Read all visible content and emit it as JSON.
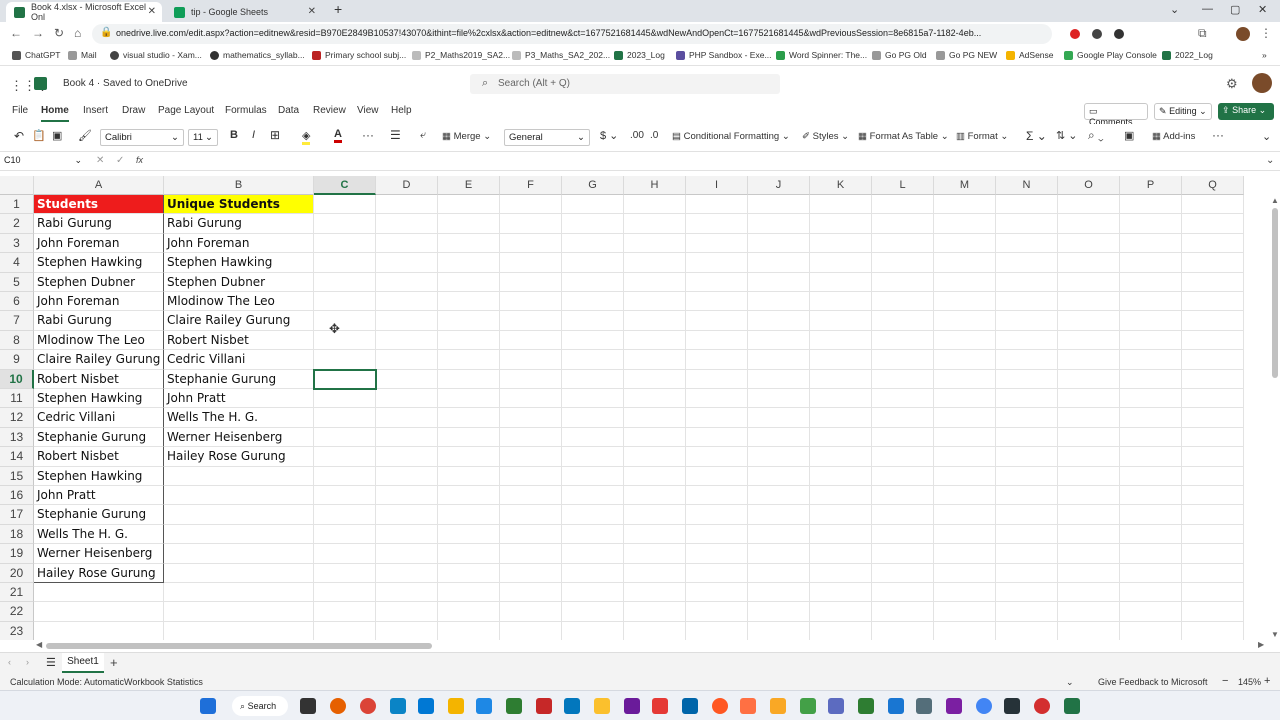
{
  "browser": {
    "tabs": [
      {
        "title": "Book 4.xlsx - Microsoft Excel Onl",
        "color": "#217346"
      },
      {
        "title": "tip - Google Sheets",
        "color": "#0f9d58"
      }
    ],
    "url": "onedrive.live.com/edit.aspx?action=editnew&resid=B970E2849B10537!43070&ithint=file%2cxlsx&action=editnew&ct=1677521681445&wdNewAndOpenCt=1677521681445&wdPreviousSession=8e6815a7-1182-4eb...",
    "bookmarks": [
      "ChatGPT",
      "Mail",
      "visual studio - Xam...",
      "mathematics_syllab...",
      "Primary school subj...",
      "P2_Maths2019_SA2...",
      "P3_Maths_SA2_202...",
      "2023_Log",
      "PHP Sandbox - Exe...",
      "Word Spinner: The...",
      "Go PG Old",
      "Go PG NEW",
      "AdSense",
      "Google Play Console",
      "2022_Log"
    ]
  },
  "excel": {
    "doc_title": "Book 4 · Saved to OneDrive",
    "search_placeholder": "Search (Alt + Q)",
    "menu": [
      "File",
      "Home",
      "Insert",
      "Draw",
      "Page Layout",
      "Formulas",
      "Data",
      "Review",
      "View",
      "Help"
    ],
    "comments_label": "Comments",
    "editing_label": "Editing",
    "share_label": "Share",
    "ribbon": {
      "font": "Calibri",
      "size": "11",
      "merge": "Merge",
      "number_format": "General",
      "conditional": "Conditional Formatting",
      "styles": "Styles",
      "format_table": "Format As Table",
      "format": "Format",
      "addins": "Add-ins"
    },
    "name_box": "C10",
    "fx": "fx",
    "columns": [
      "A",
      "B",
      "C",
      "D",
      "E",
      "F",
      "G",
      "H",
      "I",
      "J",
      "K",
      "L",
      "M",
      "N",
      "O",
      "P",
      "Q"
    ],
    "rows": [
      "1",
      "2",
      "3",
      "4",
      "5",
      "6",
      "7",
      "8",
      "9",
      "10",
      "11",
      "12",
      "13",
      "14",
      "15",
      "16",
      "17",
      "18",
      "19",
      "20",
      "21",
      "22",
      "23"
    ],
    "colA": [
      "Students",
      "Rabi Gurung",
      "John Foreman",
      "Stephen Hawking",
      "Stephen Dubner",
      "John Foreman",
      "Rabi Gurung",
      "Mlodinow The Leo",
      "Claire Railey Gurung",
      "Robert Nisbet",
      "Stephen Hawking",
      "Cedric Villani",
      "Stephanie Gurung",
      "Robert Nisbet",
      "Stephen Hawking",
      "John Pratt",
      "Stephanie Gurung",
      "Wells The H. G.",
      "Werner Heisenberg",
      "Hailey Rose Gurung"
    ],
    "colB": [
      "Unique Students",
      "Rabi Gurung",
      "John Foreman",
      "Stephen Hawking",
      "Stephen Dubner",
      "Mlodinow The Leo",
      "Claire Railey Gurung",
      "Robert Nisbet",
      "Cedric Villani",
      "Stephanie Gurung",
      "John Pratt",
      "Wells The H. G.",
      "Werner Heisenberg",
      "Hailey Rose Gurung"
    ],
    "sheet_tab": "Sheet1",
    "status_left": "Calculation Mode: Automatic",
    "status_stats": "Workbook Statistics",
    "feedback": "Give Feedback to Microsoft",
    "zoom": "145%"
  },
  "taskbar": {
    "search": "Search"
  },
  "colors": {
    "excel_green": "#217346",
    "header_red": "#ee1c1c",
    "header_yellow": "#ffff00"
  }
}
